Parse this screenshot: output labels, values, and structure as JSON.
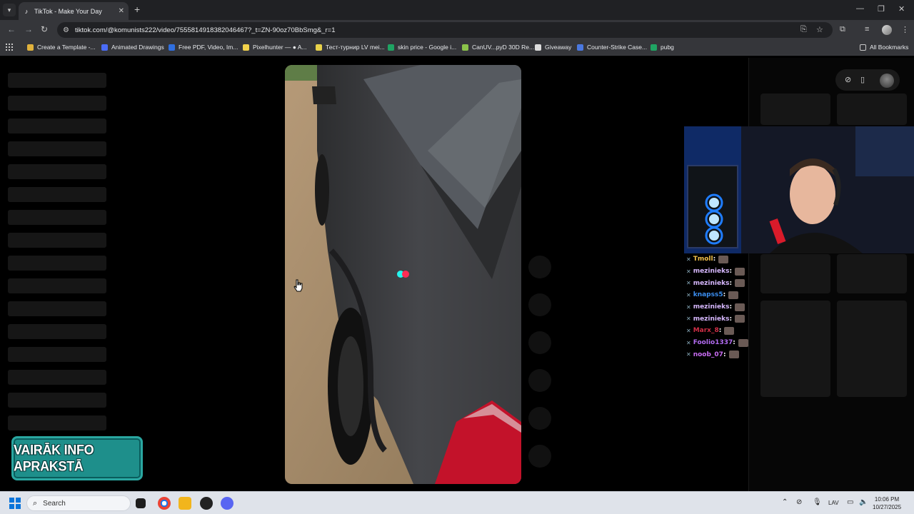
{
  "browser": {
    "tab": {
      "title": "TikTok - Make Your Day",
      "favicon": "tiktok-icon"
    },
    "new_tab_glyph": "+",
    "address": {
      "url": "tiktok.com/@komunists222/video/7555814918382046467?_t=ZN-90oz70BbSmg&_r=1"
    },
    "bookmarks": [
      {
        "label": "Create a Template -...",
        "color": "#e0b23c"
      },
      {
        "label": "Animated Drawings",
        "color": "#4a6cf7"
      },
      {
        "label": "Free PDF, Video, Im...",
        "color": "#2f6fe0"
      },
      {
        "label": "Pixelhunter — ● A...",
        "color": "#f2d24b"
      },
      {
        "label": "Тест-турнир LV mei...",
        "color": "#e8d24a"
      },
      {
        "label": "skin price - Google i...",
        "color": "#1fa463"
      },
      {
        "label": "CanUV...pyD 30D Re...",
        "color": "#8bc34a"
      },
      {
        "label": "Giveaway",
        "color": "#dddddd"
      },
      {
        "label": "Counter-Strike Case...",
        "color": "#4a78e0"
      },
      {
        "label": "pubg",
        "color": "#1fa463"
      }
    ],
    "all_bookmarks": "All Bookmarks"
  },
  "overlay": {
    "promo_text": "VAIRĀK INFO APRAKSTĀ",
    "chat": [
      {
        "user": "Tmoll",
        "color": "#f1c04a"
      },
      {
        "user": "mezinieks",
        "color": "#d7b8ff"
      },
      {
        "user": "mezinieks",
        "color": "#d7b8ff"
      },
      {
        "user": "knapss5",
        "color": "#3b8ef0"
      },
      {
        "user": "mezinieks",
        "color": "#d7b8ff"
      },
      {
        "user": "mezinieks",
        "color": "#d7b8ff"
      },
      {
        "user": "Marx_8",
        "color": "#d02f47"
      },
      {
        "user": "Foolio1337",
        "color": "#b36cf2"
      },
      {
        "user": "noob_07",
        "color": "#c86cf2"
      }
    ],
    "chat_separator": " :"
  },
  "taskbar": {
    "search_placeholder": "Search",
    "language": "LAV",
    "time": "10:06 PM",
    "date": "10/27/2025"
  }
}
